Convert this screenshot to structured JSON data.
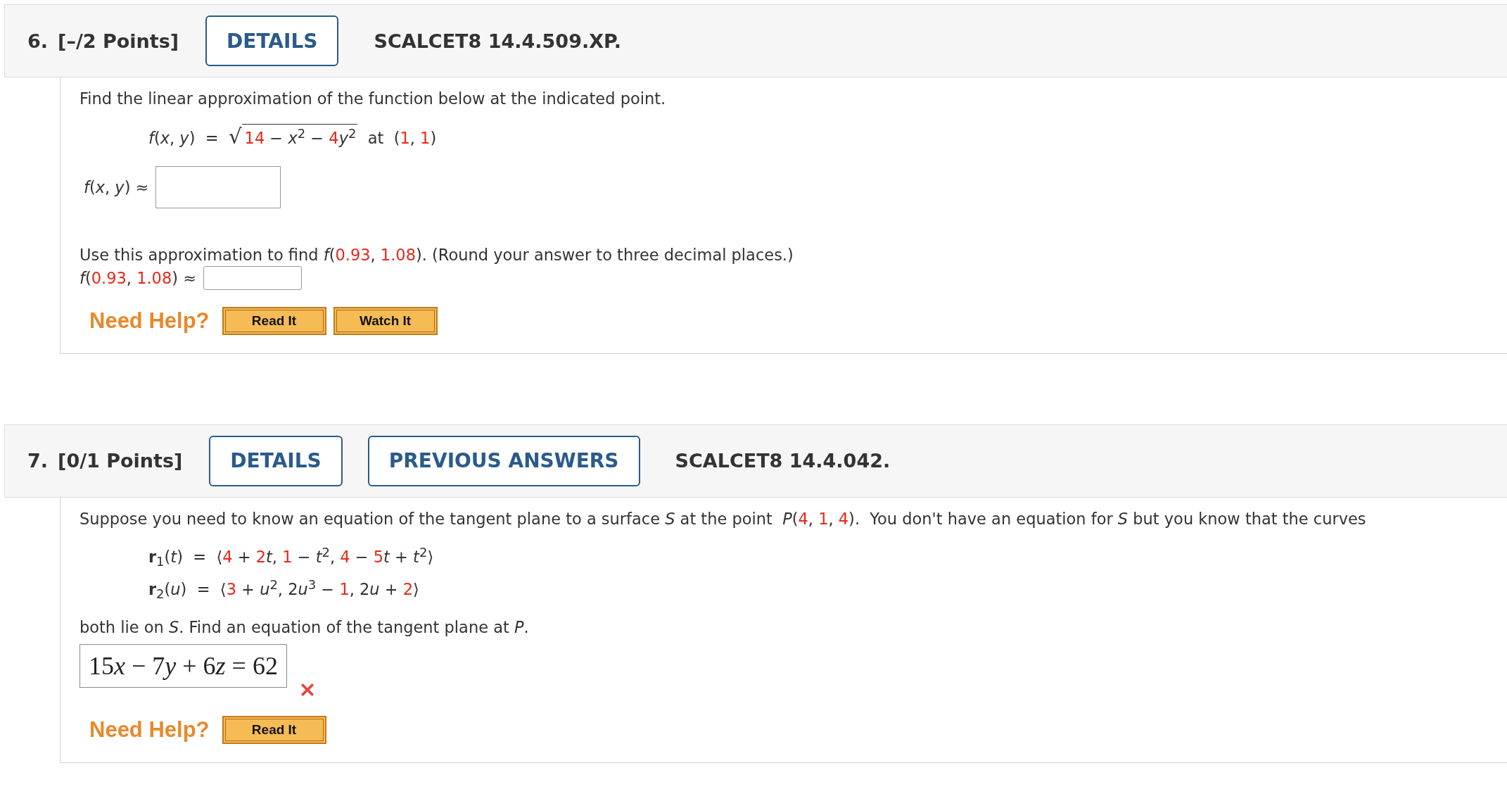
{
  "questions": [
    {
      "number": "6.",
      "points": "[–/2 Points]",
      "buttons": [
        {
          "label": "DETAILS"
        }
      ],
      "code": "SCALCET8 14.4.509.XP.",
      "body": [
        {
          "kind": "para",
          "parts": [
            {
              "kind": "plain",
              "text": "Find the linear approximation of the function below at the indicated point."
            }
          ]
        },
        {
          "kind": "display",
          "parts": [
            {
              "kind": "var",
              "text": "f"
            },
            {
              "kind": "plain",
              "text": "("
            },
            {
              "kind": "var",
              "text": "x"
            },
            {
              "kind": "plain",
              "text": ", "
            },
            {
              "kind": "var",
              "text": "y"
            },
            {
              "kind": "plain",
              "text": ")  =  "
            },
            {
              "kind": "sqrt",
              "text": "√",
              "parts": [
                {
                  "kind": "given",
                  "text": "14"
                },
                {
                  "kind": "plain",
                  "text": " − "
                },
                {
                  "kind": "var",
                  "text": "x"
                },
                {
                  "kind": "sup",
                  "text": "2"
                },
                {
                  "kind": "plain",
                  "text": " − "
                },
                {
                  "kind": "given",
                  "text": "4"
                },
                {
                  "kind": "var",
                  "text": "y"
                },
                {
                  "kind": "sup",
                  "text": "2"
                }
              ]
            },
            {
              "kind": "plain",
              "text": "  at  ("
            },
            {
              "kind": "given",
              "text": "1"
            },
            {
              "kind": "plain",
              "text": ", "
            },
            {
              "kind": "given",
              "text": "1"
            },
            {
              "kind": "plain",
              "text": ")"
            }
          ]
        },
        {
          "kind": "boxfield",
          "parts": [
            {
              "kind": "var",
              "text": "f"
            },
            {
              "kind": "plain",
              "text": "("
            },
            {
              "kind": "var",
              "text": "x"
            },
            {
              "kind": "plain",
              "text": ", "
            },
            {
              "kind": "var",
              "text": "y"
            },
            {
              "kind": "plain",
              "text": ") ≈"
            }
          ]
        },
        {
          "kind": "para",
          "parts": [
            {
              "kind": "plain",
              "text": "Use this approximation to find "
            },
            {
              "kind": "var",
              "text": "f"
            },
            {
              "kind": "plain",
              "text": "("
            },
            {
              "kind": "given",
              "text": "0.93"
            },
            {
              "kind": "plain",
              "text": ", "
            },
            {
              "kind": "given",
              "text": "1.08"
            },
            {
              "kind": "plain",
              "text": "). (Round your answer to three decimal places.)"
            }
          ]
        },
        {
          "kind": "linefield",
          "parts": [
            {
              "kind": "var",
              "text": "f"
            },
            {
              "kind": "plain",
              "text": "("
            },
            {
              "kind": "given",
              "text": "0.93"
            },
            {
              "kind": "plain",
              "text": ", "
            },
            {
              "kind": "given",
              "text": "1.08"
            },
            {
              "kind": "plain",
              "text": ") ≈"
            }
          ]
        }
      ],
      "help": {
        "label": "Need Help?",
        "buttons": [
          "Read It",
          "Watch It"
        ]
      }
    },
    {
      "number": "7.",
      "points": "[0/1 Points]",
      "buttons": [
        {
          "label": "DETAILS"
        },
        {
          "label": "PREVIOUS ANSWERS"
        }
      ],
      "code": "SCALCET8 14.4.042.",
      "body": [
        {
          "kind": "para",
          "parts": [
            {
              "kind": "plain",
              "text": "Suppose you need to know an equation of the tangent plane to a surface "
            },
            {
              "kind": "var",
              "text": "S"
            },
            {
              "kind": "plain",
              "text": " at the point  "
            },
            {
              "kind": "var",
              "text": "P"
            },
            {
              "kind": "plain",
              "text": "("
            },
            {
              "kind": "given",
              "text": "4"
            },
            {
              "kind": "plain",
              "text": ", "
            },
            {
              "kind": "given",
              "text": "1"
            },
            {
              "kind": "plain",
              "text": ", "
            },
            {
              "kind": "given",
              "text": "4"
            },
            {
              "kind": "plain",
              "text": ").  You don't have an equation for "
            },
            {
              "kind": "var",
              "text": "S"
            },
            {
              "kind": "plain",
              "text": " but you know that the curves"
            }
          ]
        },
        {
          "kind": "display",
          "parts": [
            {
              "kind": "bold",
              "text": "r"
            },
            {
              "kind": "sub",
              "text": "1"
            },
            {
              "kind": "plain",
              "text": "("
            },
            {
              "kind": "var",
              "text": "t"
            },
            {
              "kind": "plain",
              "text": ")  =  ⟨"
            },
            {
              "kind": "given",
              "text": "4"
            },
            {
              "kind": "plain",
              "text": " + "
            },
            {
              "kind": "given",
              "text": "2"
            },
            {
              "kind": "var",
              "text": "t"
            },
            {
              "kind": "plain",
              "text": ", "
            },
            {
              "kind": "given",
              "text": "1"
            },
            {
              "kind": "plain",
              "text": " − "
            },
            {
              "kind": "var",
              "text": "t"
            },
            {
              "kind": "sup",
              "text": "2"
            },
            {
              "kind": "plain",
              "text": ", "
            },
            {
              "kind": "given",
              "text": "4"
            },
            {
              "kind": "plain",
              "text": " − "
            },
            {
              "kind": "given",
              "text": "5"
            },
            {
              "kind": "var",
              "text": "t"
            },
            {
              "kind": "plain",
              "text": " + "
            },
            {
              "kind": "var",
              "text": "t"
            },
            {
              "kind": "sup",
              "text": "2"
            },
            {
              "kind": "plain",
              "text": "⟩"
            }
          ]
        },
        {
          "kind": "display",
          "parts": [
            {
              "kind": "bold",
              "text": "r"
            },
            {
              "kind": "sub",
              "text": "2"
            },
            {
              "kind": "plain",
              "text": "("
            },
            {
              "kind": "var",
              "text": "u"
            },
            {
              "kind": "plain",
              "text": ")  =  ⟨"
            },
            {
              "kind": "given",
              "text": "3"
            },
            {
              "kind": "plain",
              "text": " + "
            },
            {
              "kind": "var",
              "text": "u"
            },
            {
              "kind": "sup",
              "text": "2"
            },
            {
              "kind": "plain",
              "text": ", 2"
            },
            {
              "kind": "var",
              "text": "u"
            },
            {
              "kind": "sup",
              "text": "3"
            },
            {
              "kind": "plain",
              "text": " − "
            },
            {
              "kind": "given",
              "text": "1"
            },
            {
              "kind": "plain",
              "text": ", 2"
            },
            {
              "kind": "var",
              "text": "u"
            },
            {
              "kind": "plain",
              "text": " + "
            },
            {
              "kind": "given",
              "text": "2"
            },
            {
              "kind": "plain",
              "text": "⟩"
            }
          ]
        },
        {
          "kind": "para",
          "parts": [
            {
              "kind": "plain",
              "text": "both lie on "
            },
            {
              "kind": "var",
              "text": "S"
            },
            {
              "kind": "plain",
              "text": ". Find an equation of the tangent plane at "
            },
            {
              "kind": "var",
              "text": "P"
            },
            {
              "kind": "plain",
              "text": "."
            }
          ]
        },
        {
          "kind": "answer",
          "correct": false,
          "parts": [
            {
              "kind": "plain",
              "text": "15"
            },
            {
              "kind": "var",
              "text": "x"
            },
            {
              "kind": "plain",
              "text": " − 7"
            },
            {
              "kind": "var",
              "text": "y"
            },
            {
              "kind": "plain",
              "text": " + 6"
            },
            {
              "kind": "var",
              "text": "z"
            },
            {
              "kind": "plain",
              "text": " = 62"
            }
          ]
        }
      ],
      "help": {
        "label": "Need Help?",
        "buttons": [
          "Read It"
        ]
      }
    }
  ]
}
